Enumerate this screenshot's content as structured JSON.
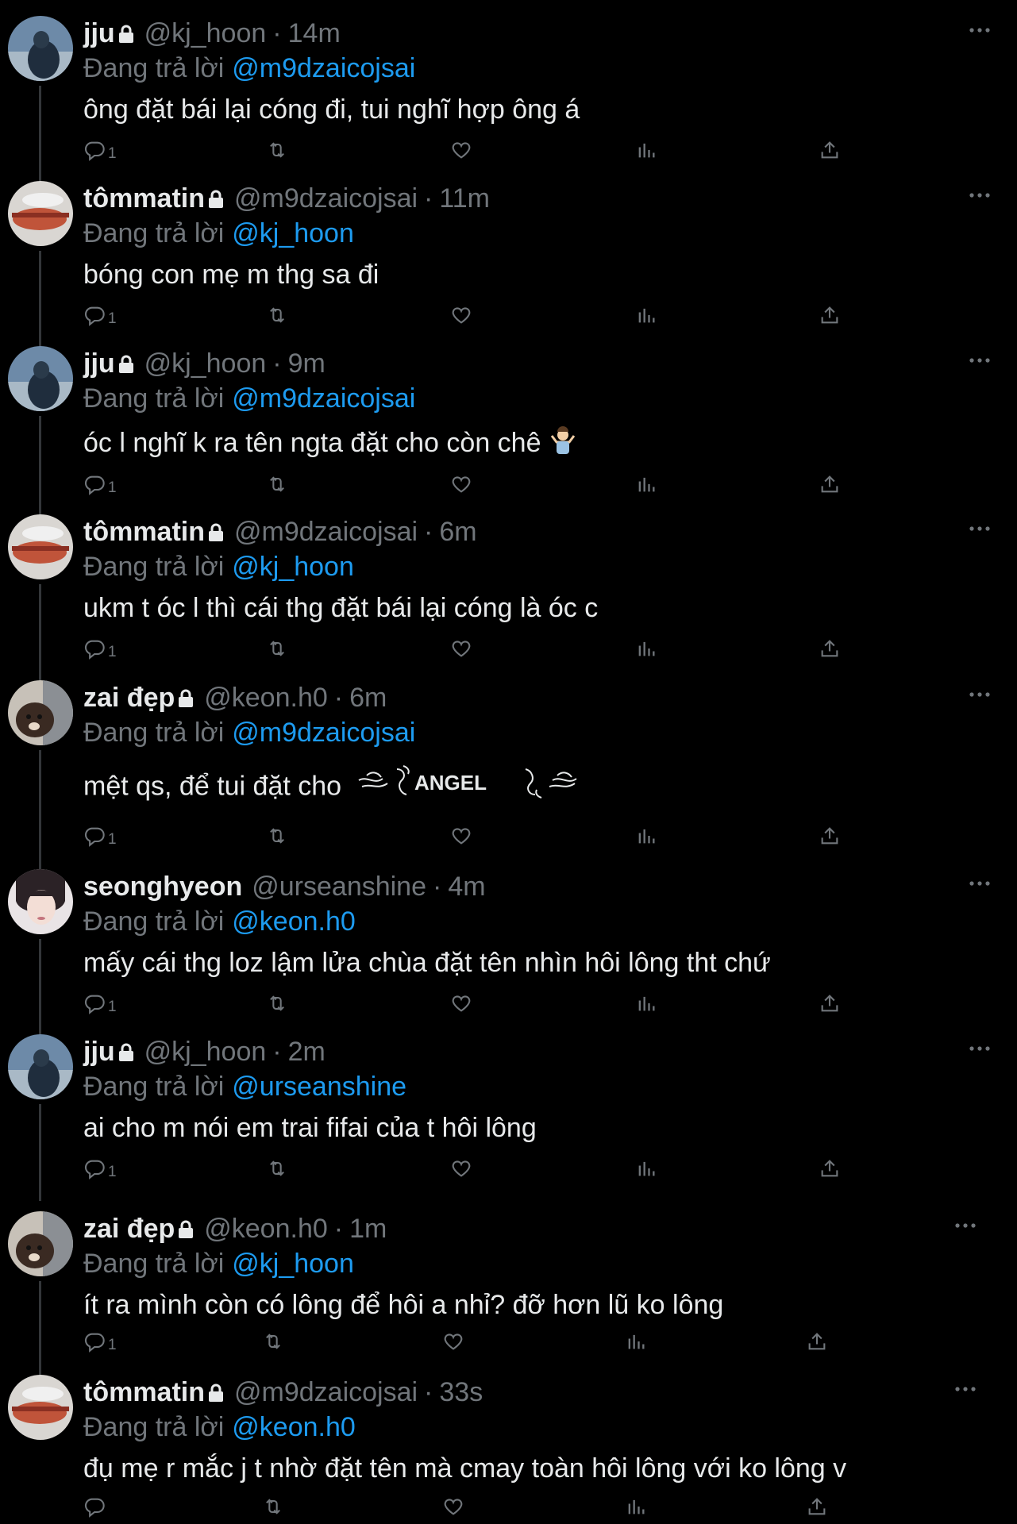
{
  "replying_label": "Đang trả lời",
  "tweets": [
    {
      "name": "jju",
      "handle": "@kj_hoon",
      "time": "14m",
      "reply_to": "@m9dzaicojsai",
      "text": "ông đặt bái lại cóng đi, tui nghĩ hợp ông á",
      "reply_count": "1"
    },
    {
      "name": "tômmatin",
      "handle": "@m9dzaicojsai",
      "time": "11m",
      "reply_to": "@kj_hoon",
      "text": "bóng con mẹ m thg sa đi",
      "reply_count": "1"
    },
    {
      "name": "jju",
      "handle": "@kj_hoon",
      "time": "9m",
      "reply_to": "@m9dzaicojsai",
      "text": "óc l nghĩ k ra tên ngta đặt cho còn chê",
      "reply_count": "1"
    },
    {
      "name": "tômmatin",
      "handle": "@m9dzaicojsai",
      "time": "6m",
      "reply_to": "@kj_hoon",
      "text": "ukm t óc l thì cái thg đặt bái lại cóng là óc c",
      "reply_count": "1"
    },
    {
      "name": "zai đẹp",
      "handle": "@keon.h0",
      "time": "6m",
      "reply_to": "@m9dzaicojsai",
      "text": "mệt qs, để tui đặt cho",
      "decor_word": "ANGEL",
      "reply_count": "1"
    },
    {
      "name": "seonghyeon",
      "handle": "@urseanshine",
      "time": "4m",
      "reply_to": "@keon.h0",
      "text": "mấy cái thg loz lậm lửa chùa đặt tên nhìn hôi lông tht chứ",
      "reply_count": "1"
    },
    {
      "name": "jju",
      "handle": "@kj_hoon",
      "time": "2m",
      "reply_to": "@urseanshine",
      "text": "ai cho m nói em trai fifai của t hôi lông",
      "reply_count": "1"
    },
    {
      "name": "zai đẹp",
      "handle": "@keon.h0",
      "time": "1m",
      "reply_to": "@kj_hoon",
      "text": "ít ra mình còn có lông để hôi a nhỉ? đỡ hơn lũ ko lông",
      "reply_count": "1"
    },
    {
      "name": "tômmatin",
      "handle": "@m9dzaicojsai",
      "time": "33s",
      "reply_to": "@keon.h0",
      "text": "đụ mẹ r mắc j t nhờ đặt tên mà cmay toàn hôi lông với ko lông v",
      "reply_count": ""
    }
  ],
  "icons": {
    "reply": "reply-icon",
    "retweet": "retweet-icon",
    "like": "heart-icon",
    "views": "views-icon",
    "share": "share-icon",
    "more": "more-icon",
    "lock": "lock-icon"
  },
  "colors": {
    "background": "#000000",
    "text": "#e7e9ea",
    "muted": "#71767b",
    "link": "#1d9bf0"
  }
}
